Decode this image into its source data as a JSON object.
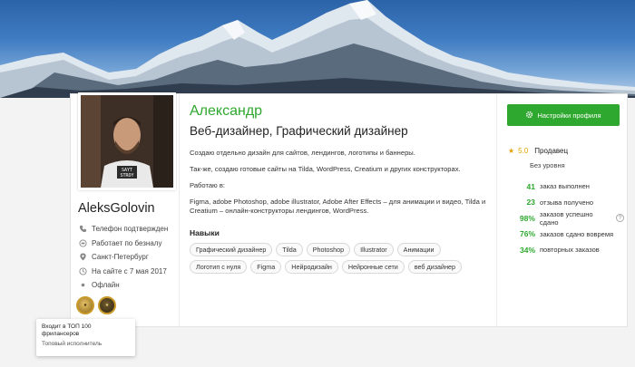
{
  "profile": {
    "username": "AleksGolovin",
    "name": "Александр",
    "profession": "Веб-дизайнер, Графический дизайнер",
    "about": [
      "Создаю отдельно дизайн для сайтов, лендингов, логотипы и баннеры.",
      "Так-же, создаю готовые сайты на Tilda, WordPress, Creatium и других конструкторах.",
      "Работаю в:",
      "Figma, adobe Photoshop, adobe illustrator, Adobe After Effects – для анимации и видео, Tilda и Creatium – онлайн-конструкторы лендингов, WordPress."
    ],
    "avatar_shirt_text": [
      "SAYT",
      "STROY"
    ]
  },
  "info": [
    {
      "icon": "phone-icon",
      "text": "Телефон подтвержден"
    },
    {
      "icon": "card-icon",
      "text": "Работает по безналу"
    },
    {
      "icon": "location-icon",
      "text": "Санкт-Петербург"
    },
    {
      "icon": "clock-icon",
      "text": "На сайте с 7 мая 2017"
    },
    {
      "icon": "status-dot-icon",
      "text": "Офлайн"
    }
  ],
  "badges": [
    "top-100-badge",
    "top-performer-badge"
  ],
  "tooltip": {
    "title": "Входит в ТОП 100 фрилансеров",
    "subtitle": "Топовый исполнитель"
  },
  "skills": {
    "title": "Навыки",
    "tags": [
      "Графический дизайнер",
      "Tilda",
      "Photoshop",
      "Illustrator",
      "Анимации",
      "Логотип с нуля",
      "Figma",
      "Нейродизайн",
      "Нейронные сети",
      "веб дизайнер"
    ]
  },
  "sidebar": {
    "settings_label": "Настройки профиля",
    "rating": "5.0",
    "role": "Продавец",
    "level": "Без уровня",
    "stats": [
      {
        "num": "41",
        "text": "заказ выполнен"
      },
      {
        "num": "23",
        "text": "отзыва получено"
      },
      {
        "num": "98%",
        "text": "заказов успешно сдано",
        "help": "?"
      },
      {
        "num": "76%",
        "text": "заказов сдано вовремя"
      },
      {
        "num": "34%",
        "text": "повторных заказов"
      }
    ]
  },
  "colors": {
    "accent": "#2ea82e",
    "star": "#e2a100"
  }
}
